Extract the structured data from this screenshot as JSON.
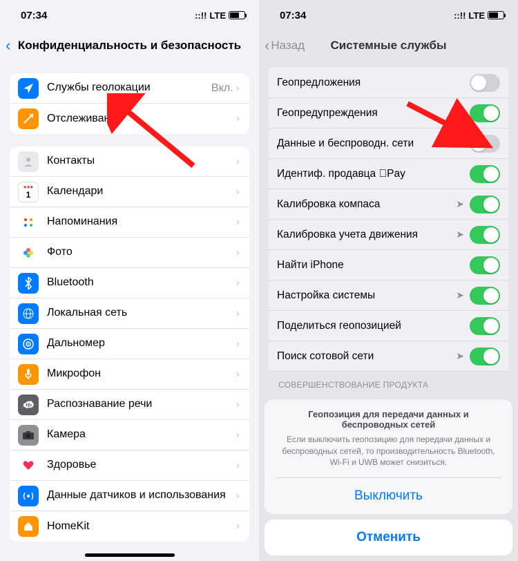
{
  "status": {
    "time": "07:34",
    "network": "LTE"
  },
  "left": {
    "title": "Конфиденциальность и безопасность",
    "group1": [
      {
        "label": "Службы геолокации",
        "trail": "Вкл.",
        "icon": "loc",
        "color": "#007aff"
      },
      {
        "label": "Отслеживание",
        "icon": "track",
        "color": "#ff9500"
      }
    ],
    "group2": [
      {
        "label": "Контакты",
        "icon": "contacts",
        "color": "#e9e9ee"
      },
      {
        "label": "Календари",
        "icon": "cal",
        "color": "#fff"
      },
      {
        "label": "Напоминания",
        "icon": "remind",
        "color": "#fff"
      },
      {
        "label": "Фото",
        "icon": "photos",
        "color": "#fff"
      },
      {
        "label": "Bluetooth",
        "icon": "bt",
        "color": "#007aff"
      },
      {
        "label": "Локальная сеть",
        "icon": "lan",
        "color": "#007aff"
      },
      {
        "label": "Дальномер",
        "icon": "range",
        "color": "#007aff"
      },
      {
        "label": "Микрофон",
        "icon": "mic",
        "color": "#ff9500"
      },
      {
        "label": "Распознавание речи",
        "icon": "speech",
        "color": "#5e5e63"
      },
      {
        "label": "Камера",
        "icon": "cam",
        "color": "#8e8e93"
      },
      {
        "label": "Здоровье",
        "icon": "health",
        "color": "#fff"
      },
      {
        "label": "Данные датчиков и использования",
        "icon": "sensor",
        "color": "#007aff"
      },
      {
        "label": "HomeKit",
        "icon": "home",
        "color": "#ff9500"
      }
    ]
  },
  "right": {
    "back": "Назад",
    "title": "Системные службы",
    "rows": [
      {
        "label": "Геопредложения",
        "on": false,
        "arrow": false
      },
      {
        "label": "Геопредупреждения",
        "on": true,
        "arrow": true
      },
      {
        "label": "Данные и беспроводн. сети",
        "on": false,
        "arrow": true
      },
      {
        "label": "Идентиф. продавца Pay",
        "on": true,
        "arrow": false,
        "apple": true
      },
      {
        "label": "Калибровка компаса",
        "on": true,
        "arrow": true
      },
      {
        "label": "Калибровка учета движения",
        "on": true,
        "arrow": true
      },
      {
        "label": "Найти iPhone",
        "on": true,
        "arrow": false
      },
      {
        "label": "Настройка системы",
        "on": true,
        "arrow": true
      },
      {
        "label": "Поделиться геопозицией",
        "on": true,
        "arrow": false
      },
      {
        "label": "Поиск сотовой сети",
        "on": true,
        "arrow": true
      }
    ],
    "footer": "СОВЕРШЕНСТВОВАНИЕ ПРОДУКТА",
    "sheet": {
      "title": "Геопозиция для передачи данных и беспроводных сетей",
      "body": "Если выключить геопозицию для передачи данных и беспроводных сетей, то производительность Bluetooth, Wi-Fi и UWB может снизиться.",
      "action": "Выключить",
      "cancel": "Отменить"
    }
  }
}
